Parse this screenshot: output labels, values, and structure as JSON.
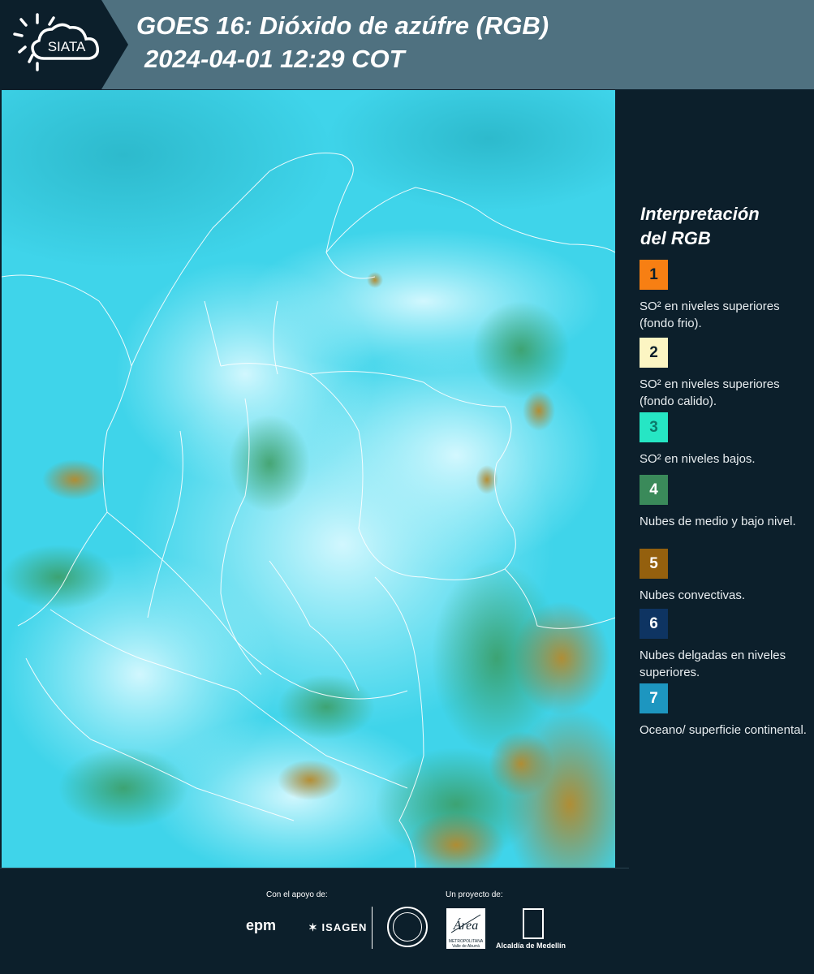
{
  "header": {
    "logo_text": "SIATA",
    "title_line1": "GOES 16: Dióxido de azúfre (RGB)",
    "title_line2": "2024-04-01 12:29 COT"
  },
  "map": {
    "description_icon": "satellite-map"
  },
  "legend": {
    "title_line1": "Interpretación",
    "title_line2": "del RGB",
    "items": [
      {
        "num": "1",
        "color": "#f77f13",
        "text": "SO² en niveles superiores (fondo frio)."
      },
      {
        "num": "2",
        "color": "#fcf5c3",
        "text": "SO² en niveles superiores (fondo calido)."
      },
      {
        "num": "3",
        "color": "#26e6c4",
        "text": "SO² en niveles bajos."
      },
      {
        "num": "4",
        "color": "#3a8a5a",
        "text": "Nubes de medio y bajo nivel."
      },
      {
        "num": "5",
        "color": "#94600e",
        "text": "Nubes convectivas."
      },
      {
        "num": "6",
        "color": "#0e3462",
        "text": "Nubes delgadas en niveles superiores."
      },
      {
        "num": "7",
        "color": "#1d96c0",
        "text": "Oceano/ superficie continental."
      }
    ]
  },
  "footer": {
    "support_label": "Con el apoyo de:",
    "project_label": "Un proyecto de:",
    "epm": "epm",
    "isagen": "ISAGEN",
    "area_metropolitana": "METROPOLITANA Valle de Aburrá",
    "area_wordmark": "Área",
    "alcaldia": "Alcaldía de Medellín"
  }
}
